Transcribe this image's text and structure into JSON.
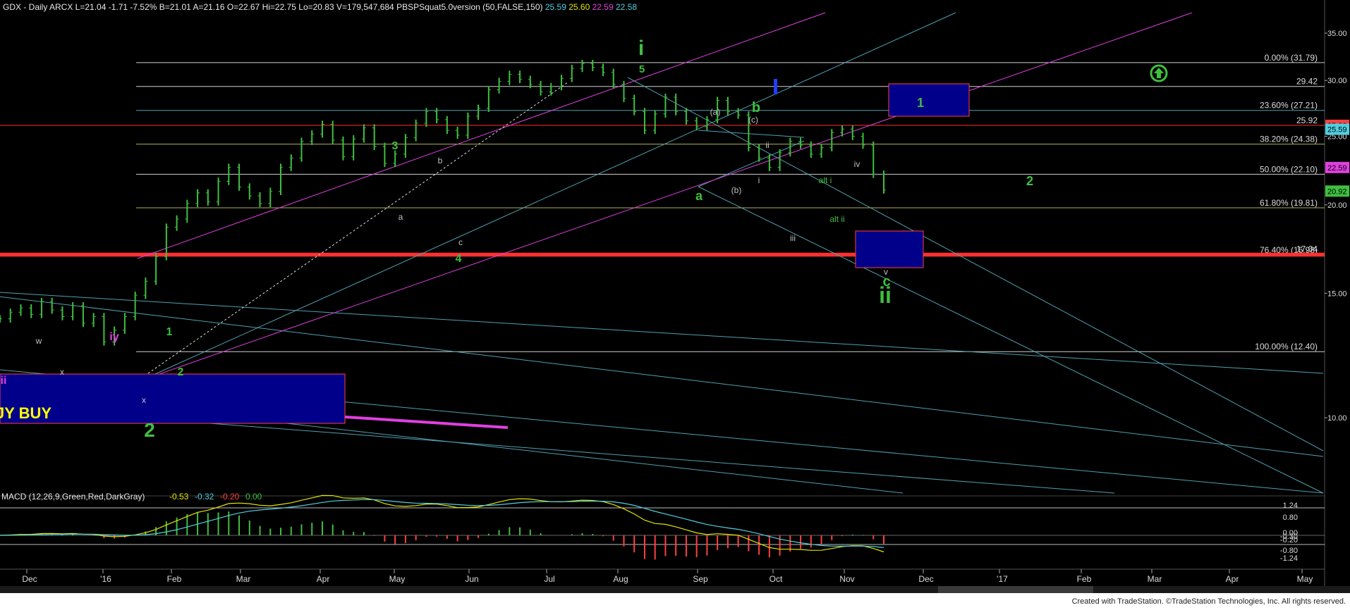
{
  "header": {
    "symbol": "GDX - Daily",
    "exchange": "ARCX",
    "quote": "L=21.04 -1.71 -7.52% B=21.01 A=21.16 O=22.67 Hi=22.75 Lo=20.83 V=179,547,684",
    "indicator": "PBSPSquat5.0version (50,FALSE,150)",
    "indicator_values": [
      "25.59",
      "25.60",
      "22.59",
      "22.58"
    ],
    "indicator_colors": [
      "#4fd0e0",
      "#e6e600",
      "#e040e0",
      "#4fd0e0"
    ]
  },
  "footer": {
    "text": "Created with TradeStation. ©TradeStation Technologies, Inc. All rights reserved."
  },
  "macd": {
    "title": "MACD (12,26,9,Green,Red,DarkGray)",
    "values": [
      "-0.53",
      "-0.32",
      "-0.20",
      "0.00"
    ],
    "value_colors": [
      "#e6e600",
      "#4fd0e0",
      "#ff4040",
      "#3fbf3f"
    ],
    "axis_labels": [
      "1.24",
      "0.80",
      "0.00",
      "-0.30",
      "-0.20",
      "-0.80",
      "-1.24"
    ]
  },
  "buy_box_text": "JY BUY",
  "chart_data": {
    "type": "line",
    "title": "GDX - Daily",
    "xlabel": "",
    "ylabel": "",
    "ylim": [
      5,
      38
    ],
    "price_ticks": [
      10.0,
      15.0,
      20.0,
      25.0,
      30.0,
      35.0
    ],
    "x_tick_labels": [
      "Dec",
      "'16",
      "Feb",
      "Mar",
      "Apr",
      "May",
      "Jun",
      "Jul",
      "Aug",
      "Sep",
      "Oct",
      "Nov",
      "Dec",
      "'17",
      "Feb",
      "Mar",
      "Apr",
      "May"
    ],
    "last_price": "20.92",
    "price_markers": [
      {
        "value": "25.92",
        "color": "#ff4040"
      },
      {
        "value": "25.59",
        "color": "#4fd0e0"
      },
      {
        "value": "22.59",
        "color": "#e040e0"
      },
      {
        "value": "20.92",
        "color": "#3fbf3f"
      }
    ],
    "fib_levels": [
      {
        "label": "0.00% (31.79)",
        "value": 31.79,
        "color": "#d0d0d0"
      },
      {
        "label": "29.42",
        "value": 29.42,
        "color": "#d0d0d0"
      },
      {
        "label": "23.60% (27.21)",
        "value": 27.21,
        "color": "#4fa0b0"
      },
      {
        "label": "25.92",
        "value": 25.92,
        "color": "#ff3030"
      },
      {
        "label": "38.20% (24.38)",
        "value": 24.38,
        "color": "#b0b050"
      },
      {
        "label": "50.00% (22.10)",
        "value": 22.1,
        "color": "#d0d0d0"
      },
      {
        "label": "61.80% (19.81)",
        "value": 19.81,
        "color": "#b0b050"
      },
      {
        "label": "76.40% (16.98)",
        "value": 16.98,
        "color": "#ff3030"
      },
      {
        "label": "17.04",
        "value": 17.04,
        "color": "#ff3030"
      },
      {
        "label": "100.00% (12.40)",
        "value": 12.4,
        "color": "#d0d0d0"
      }
    ],
    "wave_labels": [
      {
        "text": "i",
        "color": "#3fbf3f"
      },
      {
        "text": "5",
        "color": "#3fbf3f"
      },
      {
        "text": "3",
        "color": "#3fbf3f"
      },
      {
        "text": "4",
        "color": "#3fbf3f"
      },
      {
        "text": "1",
        "color": "#3fbf3f"
      },
      {
        "text": "2",
        "color": "#3fbf3f"
      },
      {
        "text": "2",
        "color": "#3fbf3f"
      },
      {
        "text": "a",
        "color": "#3fbf3f"
      },
      {
        "text": "b",
        "color": "#3fbf3f"
      },
      {
        "text": "c",
        "color": "#3fbf3f"
      },
      {
        "text": "ii",
        "color": "#3fbf3f"
      },
      {
        "text": "1",
        "color": "#3fbf3f"
      },
      {
        "text": "2",
        "color": "#3fbf3f"
      },
      {
        "text": "(a)",
        "color": "#c0c0c0"
      },
      {
        "text": "(b)",
        "color": "#c0c0c0"
      },
      {
        "text": "(c)",
        "color": "#c0c0c0"
      },
      {
        "text": "i",
        "color": "#c0c0c0"
      },
      {
        "text": "ii",
        "color": "#c0c0c0"
      },
      {
        "text": "iii",
        "color": "#c0c0c0"
      },
      {
        "text": "iv",
        "color": "#c0c0c0"
      },
      {
        "text": "v",
        "color": "#c0c0c0"
      },
      {
        "text": "alt i",
        "color": "#3fbf3f"
      },
      {
        "text": "alt ii",
        "color": "#3fbf3f"
      },
      {
        "text": "a",
        "color": "#c0c0c0"
      },
      {
        "text": "b",
        "color": "#c0c0c0"
      },
      {
        "text": "c",
        "color": "#c0c0c0"
      },
      {
        "text": "w",
        "color": "#c0c0c0"
      },
      {
        "text": "x",
        "color": "#c0c0c0"
      },
      {
        "text": "iy",
        "color": "#e040e0"
      },
      {
        "text": "x",
        "color": "#c0c0c0"
      },
      {
        "text": "ii",
        "color": "#e040e0"
      }
    ],
    "series": [
      {
        "name": "GDX",
        "color": "#3fbf3f",
        "values": [
          13.8,
          14.1,
          14.3,
          14.0,
          14.6,
          14.2,
          13.9,
          14.4,
          13.6,
          13.9,
          12.8,
          13.3,
          13.9,
          14.9,
          15.6,
          16.9,
          18.6,
          19.1,
          20.1,
          20.8,
          20.2,
          21.6,
          22.6,
          21.2,
          20.6,
          20.1,
          20.9,
          22.6,
          23.3,
          24.6,
          25.2,
          26.0,
          24.7,
          23.4,
          24.8,
          25.7,
          24.2,
          22.9,
          23.6,
          24.9,
          26.1,
          27.1,
          26.4,
          25.5,
          25.1,
          26.7,
          27.4,
          29.1,
          29.9,
          30.6,
          30.1,
          29.6,
          28.9,
          29.4,
          30.2,
          31.2,
          31.7,
          31.3,
          30.8,
          29.6,
          28.3,
          27.1,
          25.5,
          26.9,
          28.4,
          27.1,
          26.3,
          25.8,
          26.4,
          28.1,
          27.1,
          26.8,
          24.1,
          23.3,
          22.6,
          23.7,
          24.6,
          24.3,
          23.6,
          24.1,
          25.3,
          25.6,
          25.0,
          24.3,
          22.1,
          21.0
        ]
      }
    ]
  }
}
